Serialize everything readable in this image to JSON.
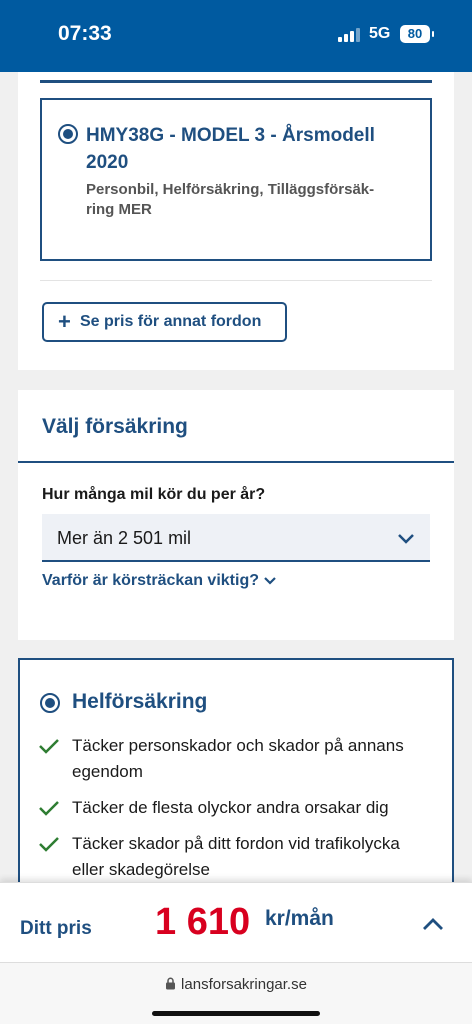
{
  "status_bar": {
    "time": "07:33",
    "network": "5G",
    "battery": "80"
  },
  "vehicle": {
    "title": "HMY38G - MODEL 3 - Årsmodell 2020",
    "description": "Personbil, Helförsäkring, Tilläggsförsäk­ring MER",
    "other_vehicle_button": "Se pris för annat fordon"
  },
  "insurance": {
    "title": "Välj försäkring",
    "mileage_question": "Hur många mil kör du per år?",
    "mileage_selected": "Mer än 2 501 mil",
    "why_link": "Varför är körsträckan viktig?"
  },
  "plan": {
    "name": "Helförsäkring",
    "features": [
      "Täcker personskador och skador på annans egendom",
      "Täcker de flesta olyckor andra orsakar dig",
      "Täcker skador på ditt fordon vid trafikolycka eller skadegörelse"
    ]
  },
  "price": {
    "label": "Ditt pris",
    "value": "1 610",
    "unit": "kr/mån"
  },
  "browser": {
    "url": "lansforsakringar.se"
  },
  "colors": {
    "primary": "#1f4f80",
    "status_bar": "#005aa0",
    "price": "#d8001f"
  }
}
